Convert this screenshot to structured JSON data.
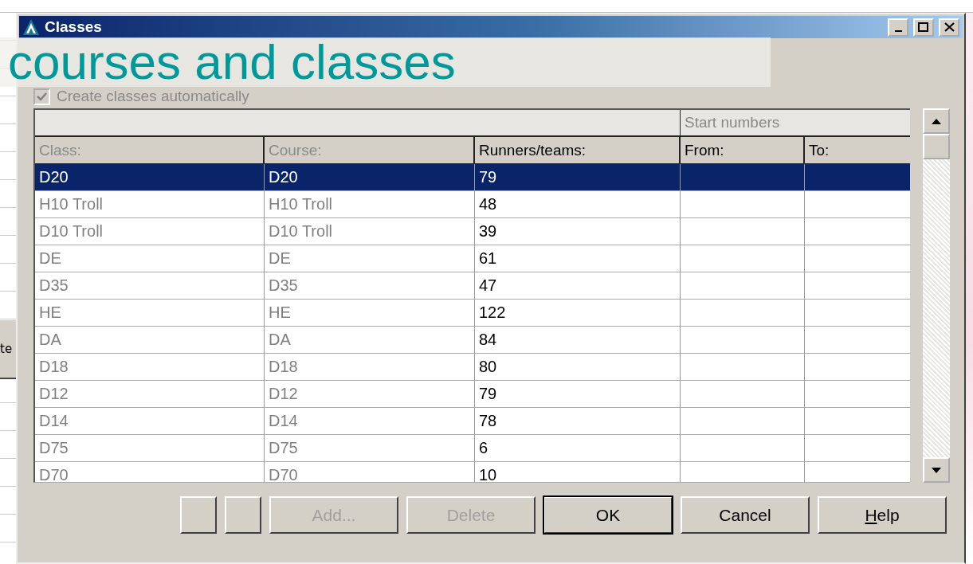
{
  "slide_title": "courses and classes",
  "background": {
    "button_fragment": "te"
  },
  "window": {
    "title": "Classes",
    "controls": [
      {
        "kind": "minimize"
      },
      {
        "kind": "maximize"
      },
      {
        "kind": "close"
      }
    ]
  },
  "auto_create": {
    "label": "Create classes automatically",
    "checked": true,
    "disabled": true
  },
  "table": {
    "group_header": "Start numbers",
    "columns": [
      {
        "label": "Class:",
        "greyed": true
      },
      {
        "label": "Course:",
        "greyed": true
      },
      {
        "label": "Runners/teams:",
        "greyed": false
      },
      {
        "label": "From:",
        "greyed": false
      },
      {
        "label": "To:",
        "greyed": false
      }
    ],
    "rows": [
      {
        "cells": [
          "D20",
          "D20",
          "79",
          "",
          ""
        ],
        "selected": true
      },
      {
        "cells": [
          "H10 Troll",
          "H10 Troll",
          "48",
          "",
          ""
        ],
        "selected": false
      },
      {
        "cells": [
          "D10 Troll",
          "D10 Troll",
          "39",
          "",
          ""
        ],
        "selected": false
      },
      {
        "cells": [
          "DE",
          "DE",
          "61",
          "",
          ""
        ],
        "selected": false
      },
      {
        "cells": [
          "D35",
          "D35",
          "47",
          "",
          ""
        ],
        "selected": false
      },
      {
        "cells": [
          "HE",
          "HE",
          "122",
          "",
          ""
        ],
        "selected": false
      },
      {
        "cells": [
          "DA",
          "DA",
          "84",
          "",
          ""
        ],
        "selected": false
      },
      {
        "cells": [
          "D18",
          "D18",
          "80",
          "",
          ""
        ],
        "selected": false
      },
      {
        "cells": [
          "D12",
          "D12",
          "79",
          "",
          ""
        ],
        "selected": false
      },
      {
        "cells": [
          "D14",
          "D14",
          "78",
          "",
          ""
        ],
        "selected": false
      },
      {
        "cells": [
          "D75",
          "D75",
          "6",
          "",
          ""
        ],
        "selected": false
      },
      {
        "cells": [
          "D70",
          "D70",
          "10",
          "",
          ""
        ],
        "selected": false
      }
    ]
  },
  "buttons": [
    {
      "kind": "small",
      "default": false
    },
    {
      "kind": "small",
      "default": false
    },
    {
      "label": "Add...",
      "kind": "wide",
      "disabled": true,
      "default": false
    },
    {
      "label": "Delete",
      "kind": "wide",
      "disabled": true,
      "default": false
    },
    {
      "label": "OK",
      "kind": "wide",
      "disabled": false,
      "default": true
    },
    {
      "label": "Cancel",
      "kind": "wide",
      "disabled": false,
      "default": false
    },
    {
      "label": "Help",
      "kind": "wide",
      "disabled": false,
      "default": false
    }
  ]
}
